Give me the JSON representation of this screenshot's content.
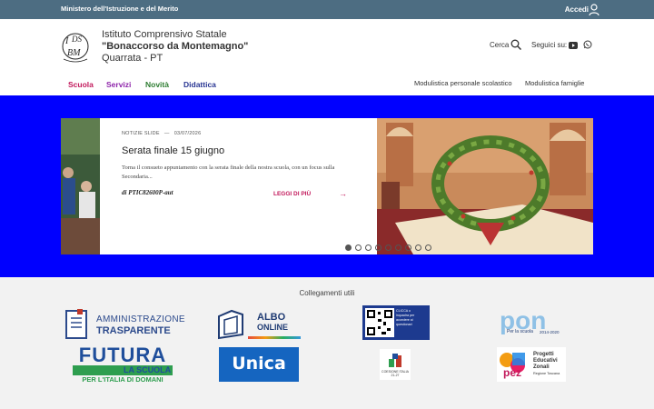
{
  "topbar": {
    "ministry": "Ministero dell'Istruzione e del Merito",
    "login": "Accedi"
  },
  "header": {
    "school_line1": "Istituto Comprensivo Statale",
    "school_line2": "\"Bonaccorso da Montemagno\"",
    "school_line3": "Quarrata - PT",
    "search": "Cerca",
    "follow": "Seguici su:"
  },
  "nav": {
    "main": [
      "Scuola",
      "Servizi",
      "Novità",
      "Didattica"
    ],
    "utility": [
      "Modulistica personale scolastico",
      "Modulistica famiglie"
    ]
  },
  "slide": {
    "category": "NOTIZIE SLIDE",
    "separator": "—",
    "date": "03/07/2026",
    "title": "Serata finale 15 giugno",
    "description": "Torna il consueto appuntamento con la serata finale della nostra scuola, con un focus sulla Secondaria...",
    "author": "di PTIC82600P-aut",
    "more": "LEGGI DI PIÙ",
    "dots_count": 9,
    "active_dot": 0
  },
  "links": {
    "title": "Collegamenti utili",
    "amministrazione_1": "AMMINISTRAZIONE",
    "amministrazione_2": "TRASPARENTE",
    "albo_1": "ALBO",
    "albo_2": "ONLINE",
    "qr_text_1": "CLICCA o",
    "qr_text_2": "inquadra per",
    "qr_text_3": "accedere ai",
    "qr_text_4": "questionari",
    "pon_small": "Per la scuola",
    "pon_years": "2014-2020",
    "futura": "FUTURA",
    "futura_2": "LA SCUOLA",
    "futura_3": "PER L'ITALIA DI DOMANI",
    "unica": "Unica",
    "coesione": "COESIONE ITALIA 21-27",
    "pez_1": "Progetti",
    "pez_2": "Educativi",
    "pez_3": "Zonali",
    "pez_4": "Regione Toscana"
  },
  "colors": {
    "topbar": "#4d6d82",
    "hero_bg": "#0000ff",
    "scuola": "#c2185b",
    "servizi": "#8e24aa",
    "novita": "#2e7d32",
    "didattica": "#283593"
  }
}
